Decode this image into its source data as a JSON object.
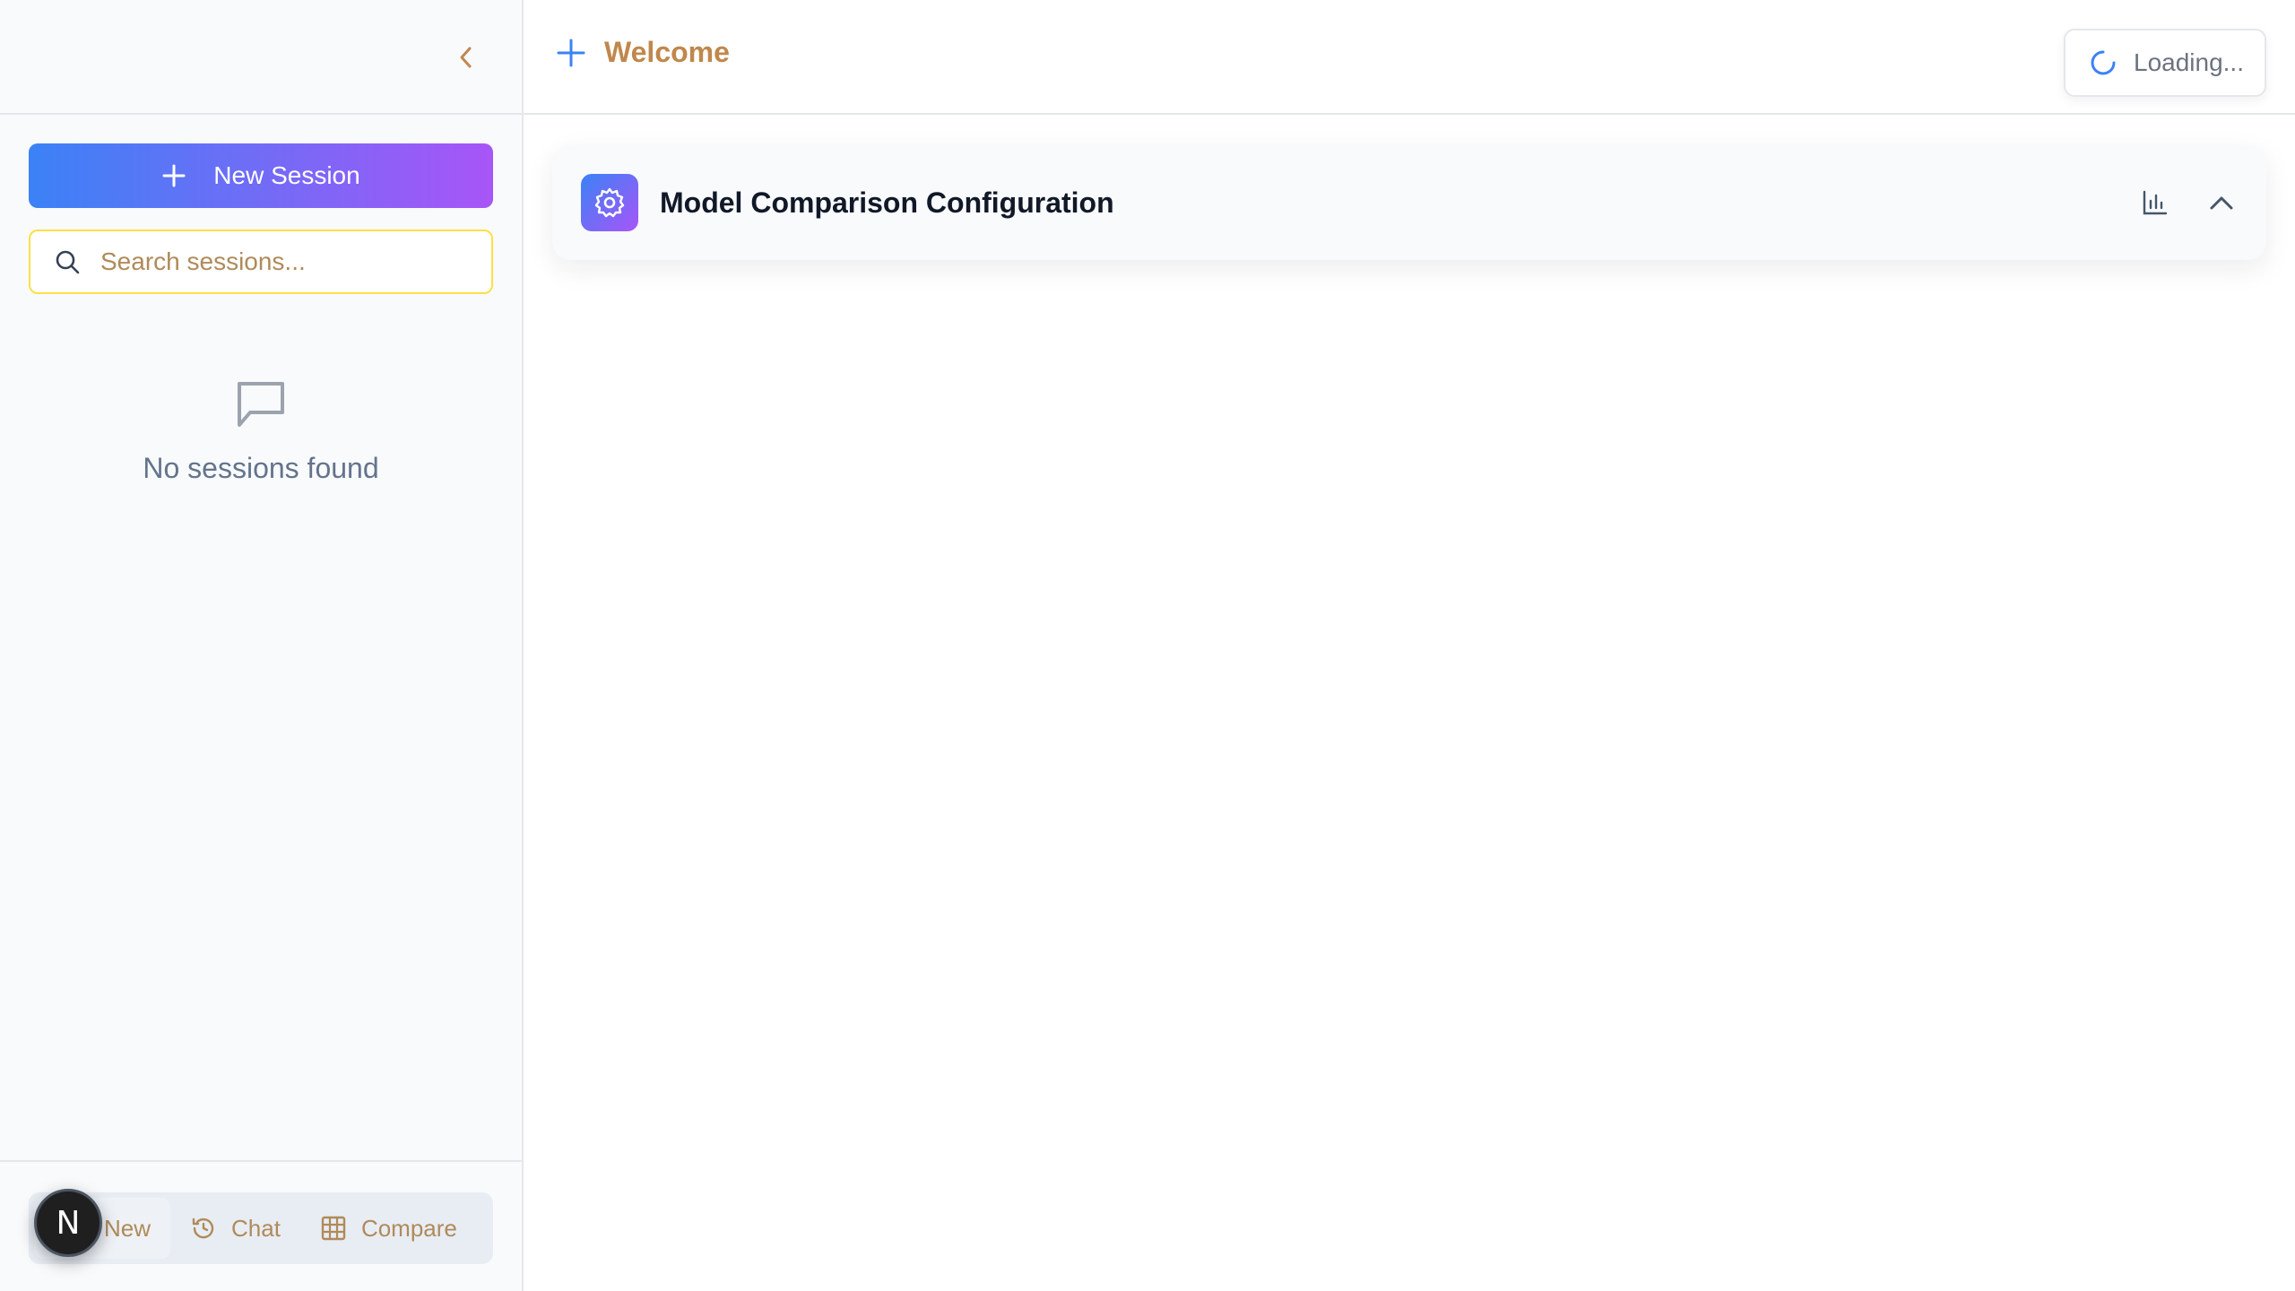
{
  "sidebar": {
    "new_session_label": "New Session",
    "search_placeholder": "Search sessions...",
    "empty_message": "No sessions found",
    "footer_tabs": [
      {
        "label": "New",
        "icon": "plus-icon"
      },
      {
        "label": "Chat",
        "icon": "history-icon"
      },
      {
        "label": "Compare",
        "icon": "grid-icon"
      }
    ],
    "badge_letter": "N"
  },
  "header": {
    "welcome_label": "Welcome",
    "status_text": "Loading..."
  },
  "config_panel": {
    "title": "Model Comparison Configuration",
    "icons": [
      "gear-icon",
      "bar-chart-icon",
      "chevron-up-icon"
    ]
  },
  "colors": {
    "gradient_start": "#3b82f6",
    "gradient_end": "#a855f7",
    "accent_text": "#c0874c",
    "search_border": "#fde047"
  }
}
